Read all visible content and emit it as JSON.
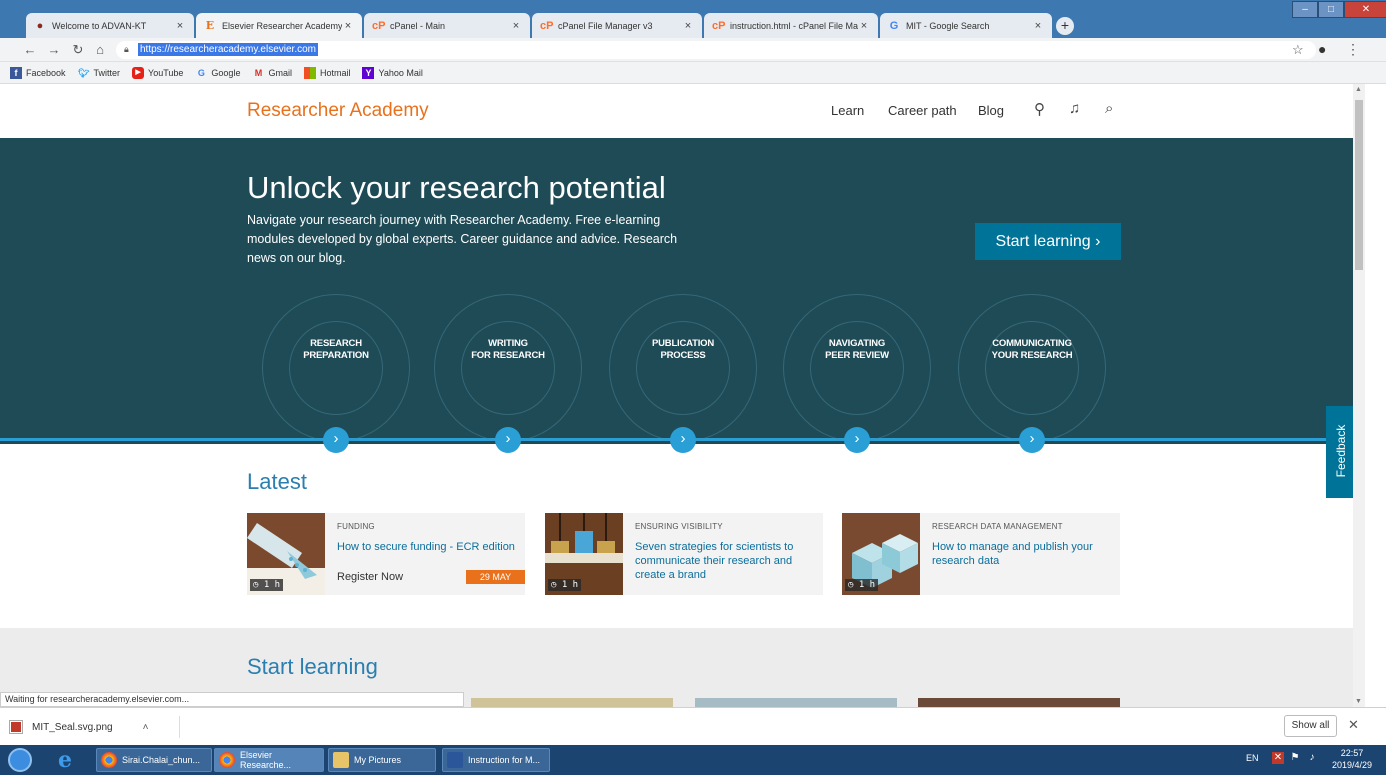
{
  "browser": {
    "tabs": [
      {
        "label": "Welcome to ADVAN-KT",
        "icon": "advan-icon"
      },
      {
        "label": "Elsevier Researcher Academy - U",
        "icon": "elsevier-icon"
      },
      {
        "label": "cPanel - Main",
        "icon": "cpanel-icon"
      },
      {
        "label": "cPanel File Manager v3",
        "icon": "cpanel-icon"
      },
      {
        "label": "instruction.html - cPanel File Ma",
        "icon": "cpanel-icon"
      },
      {
        "label": "MIT - Google Search",
        "icon": "google-icon"
      }
    ],
    "active_tab": 1,
    "url": "https://researcheracademy.elsevier.com",
    "bookmarks": [
      {
        "label": "Facebook",
        "color": "#3b5998",
        "glyph": "f"
      },
      {
        "label": "Twitter",
        "color": "#1da1f2",
        "glyph": "t"
      },
      {
        "label": "YouTube",
        "color": "#e62117",
        "glyph": "▶"
      },
      {
        "label": "Google",
        "color": "#4285f4",
        "glyph": "G"
      },
      {
        "label": "Gmail",
        "color": "#d93025",
        "glyph": "M"
      },
      {
        "label": "Hotmail",
        "color": "#f25022",
        "glyph": "■"
      },
      {
        "label": "Yahoo Mail",
        "color": "#5f01d1",
        "glyph": "Y"
      }
    ],
    "status": "Waiting for researcheracademy.elsevier.com...",
    "download": {
      "filename": "MIT_Seal.svg.png"
    },
    "show_all": "Show all"
  },
  "site": {
    "brand": "Researcher Academy",
    "nav": {
      "learn": "Learn",
      "career": "Career path",
      "blog": "Blog"
    },
    "hero": {
      "title": "Unlock your research potential",
      "text": "Navigate your research journey with Researcher Academy. Free e-learning modules developed by global experts. Career guidance and advice. Research news on our blog.",
      "cta": "Start learning"
    },
    "steps": [
      {
        "line1": "RESEARCH",
        "line2": "PREPARATION"
      },
      {
        "line1": "WRITING",
        "line2": "FOR RESEARCH"
      },
      {
        "line1": "PUBLICATION",
        "line2": "PROCESS"
      },
      {
        "line1": "NAVIGATING",
        "line2": "PEER REVIEW"
      },
      {
        "line1": "COMMUNICATING",
        "line2": "YOUR RESEARCH"
      }
    ],
    "feedback": "Feedback",
    "latest": {
      "title": "Latest",
      "cards": [
        {
          "category": "FUNDING",
          "title": "How to secure funding - ECR edition",
          "duration": "1 h",
          "register": "Register Now",
          "date": "29 MAY"
        },
        {
          "category": "ENSURING VISIBILITY",
          "title": "Seven strategies for scientists to communicate their research and create a brand",
          "duration": "1 h"
        },
        {
          "category": "RESEARCH DATA MANAGEMENT",
          "title": "How to manage and publish your research data",
          "duration": "1 h"
        }
      ]
    },
    "start_learning": {
      "title": "Start learning"
    }
  },
  "taskbar": {
    "items": [
      {
        "label": "Sirai.Chalai_chun..."
      },
      {
        "label": "Elsevier Researche..."
      },
      {
        "label": "My Pictures"
      },
      {
        "label": "Instruction for M..."
      }
    ],
    "lang": "EN",
    "time": "22:57",
    "date": "2019/4/29"
  }
}
